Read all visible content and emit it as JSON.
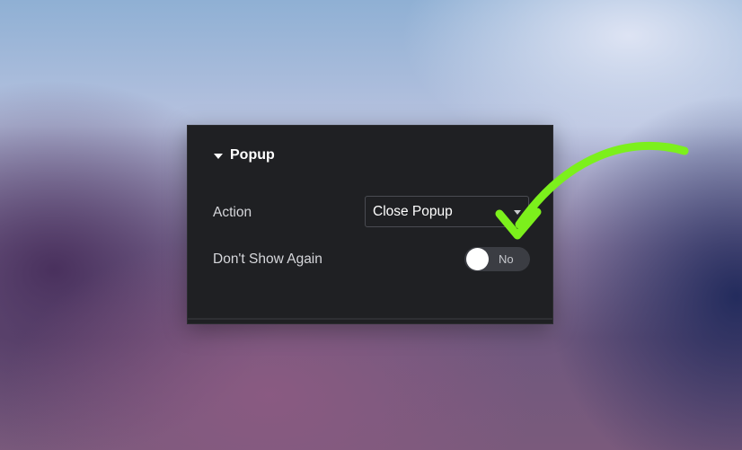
{
  "panel": {
    "section_title": "Popup",
    "action_label": "Action",
    "action_value": "Close Popup",
    "dont_show_label": "Don't Show Again",
    "toggle_text": "No"
  },
  "colors": {
    "panel_bg": "#1f2023",
    "arrow": "#7cf01c",
    "toggle_bg": "#3b3d43"
  },
  "icons": [
    "caret-down-icon",
    "chevron-down-icon",
    "arrow-annotation-icon"
  ]
}
